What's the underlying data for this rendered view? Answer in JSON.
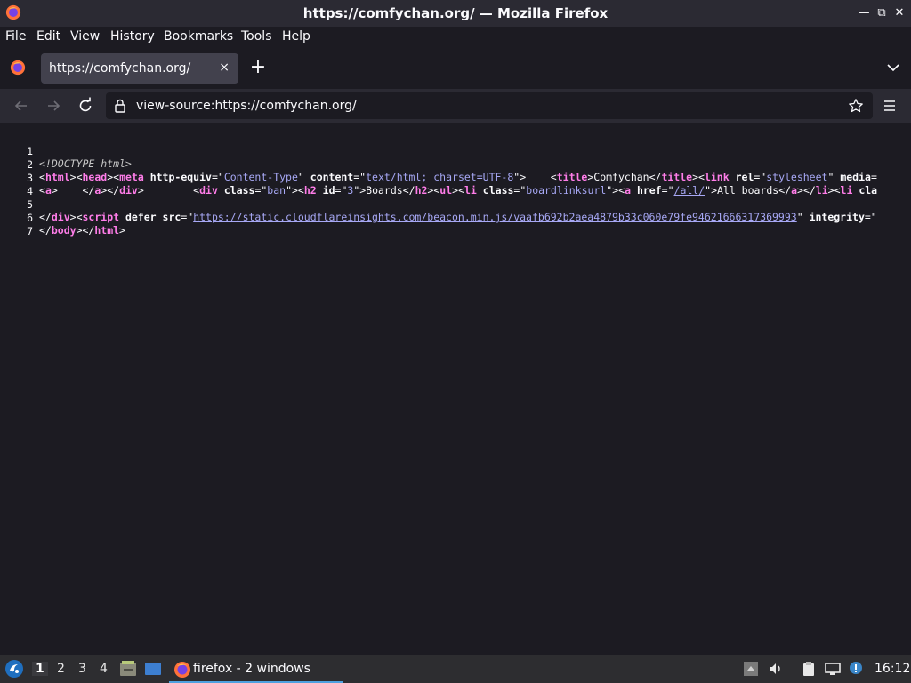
{
  "window": {
    "title": "https://comfychan.org/ — Mozilla Firefox"
  },
  "menu": {
    "file": "File",
    "edit": "Edit",
    "view": "View",
    "history": "History",
    "bookmarks": "Bookmarks",
    "tools": "Tools",
    "help": "Help"
  },
  "tab": {
    "label": "https://comfychan.org/",
    "close": "×"
  },
  "newtab_symbol": "+",
  "urlbar": {
    "url": "view-source:https://comfychan.org/"
  },
  "source": {
    "line_numbers": [
      "1",
      "2",
      "3",
      "4",
      "5",
      "6",
      "7"
    ],
    "l1_doctype": "<!DOCTYPE html>",
    "l2": {
      "p1": "<",
      "html": "html",
      "p2": "><",
      "head": "head",
      "p3": "><",
      "meta": "meta",
      "sp1": " ",
      "a_httpequiv": "http-equiv",
      "eq1": "=\"",
      "v_ct": "Content-Type",
      "q1": "\" ",
      "a_content": "content",
      "eq2": "=\"",
      "v_charset": "text/html; charset=UTF-8",
      "q2": "\">    <",
      "title": "title",
      "p4": ">Comfychan</",
      "title2": "title",
      "p5": "><",
      "link": "link",
      "sp2": " ",
      "a_rel": "rel",
      "eq3": "=\"",
      "v_rel": "stylesheet",
      "q3": "\" ",
      "a_media": "media",
      "tail": "="
    },
    "l3": {
      "p1": "<",
      "a": "a",
      "p2": ">    </",
      "a2": "a",
      "p3": "></",
      "div": "div",
      "p4": ">        <",
      "div2": "div",
      "sp1": " ",
      "a_class": "class",
      "eq1": "=\"",
      "v_ban": "ban",
      "q1": "\"><",
      "h2": "h2",
      "sp2": " ",
      "a_id": "id",
      "eq2": "=\"",
      "v_3": "3",
      "q2": "\">Boards</",
      "h2b": "h2",
      "p5": "><",
      "ul": "ul",
      "p6": "><",
      "li": "li",
      "sp3": " ",
      "a_class2": "class",
      "eq3": "=\"",
      "v_blu": "boardlinksurl",
      "q3": "\"><",
      "a3": "a",
      "sp4": " ",
      "a_href": "href",
      "eq4": "=\"",
      "v_all": "/all/",
      "q4": "\">All boards</",
      "a4": "a",
      "p7": "></",
      "li2": "li",
      "p8": "><",
      "li3": "li",
      "sp5": " ",
      "a_cla": "cla"
    },
    "l5": {
      "p1": "</",
      "div": "div",
      "p2": "><",
      "script": "script",
      "sp1": " ",
      "a_defer": "defer",
      "sp2": " ",
      "a_src": "src",
      "eq1": "=\"",
      "v_src": "https://static.cloudflareinsights.com/beacon.min.js/vaafb692b2aea4879b33c060e79fe94621666317369993",
      "q1": "\" ",
      "a_integrity": "integrity",
      "tail": "=\""
    },
    "l6": {
      "p1": "</",
      "body": "body",
      "p2": "></",
      "html": "html",
      "p3": ">"
    }
  },
  "taskbar": {
    "workspaces": [
      "1",
      "2",
      "3",
      "4"
    ],
    "active_workspace": "1",
    "task_label": "firefox - 2 windows",
    "clock": "16:12"
  },
  "colors": {
    "tag": "#ff7de9",
    "attribute_value": "#a7a8f5",
    "background": "#1c1b22",
    "chrome": "#2b2a33"
  }
}
